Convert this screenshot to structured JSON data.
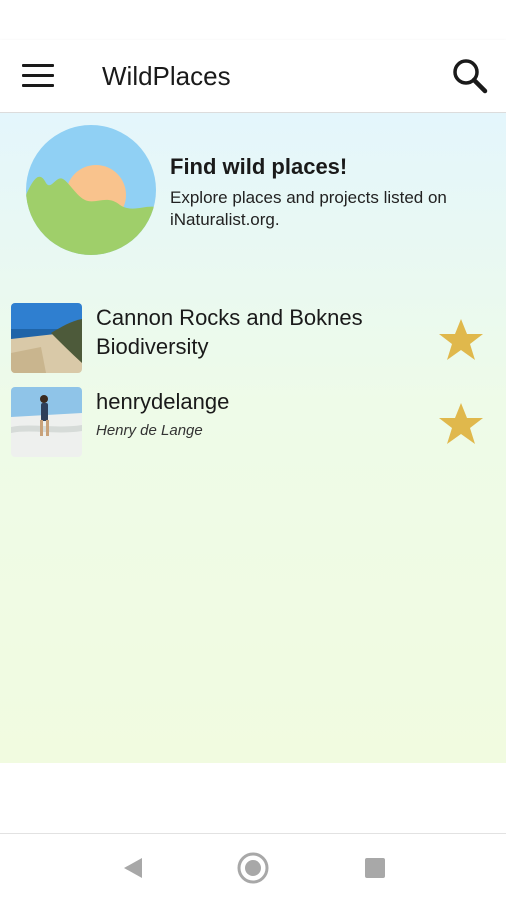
{
  "app_bar": {
    "title": "WildPlaces",
    "menu_icon": "hamburger-menu-icon",
    "search_icon": "search-icon"
  },
  "intro": {
    "heading": "Find wild places!",
    "text": "Explore places and projects listed on iNaturalist.org."
  },
  "places": [
    {
      "title": "Cannon Rocks and Boknes Biodiversity",
      "subtitle": "",
      "favorite": true
    },
    {
      "title": "henrydelange",
      "subtitle": "Henry de Lange",
      "favorite": true
    }
  ],
  "colors": {
    "star": "#e0b84c",
    "sky": "#90d0f4",
    "sun": "#f9c38d",
    "hills": "#9fcf6a"
  },
  "nav": {
    "back_icon": "back-triangle-icon",
    "home_icon": "home-circle-icon",
    "recents_icon": "recents-square-icon"
  }
}
